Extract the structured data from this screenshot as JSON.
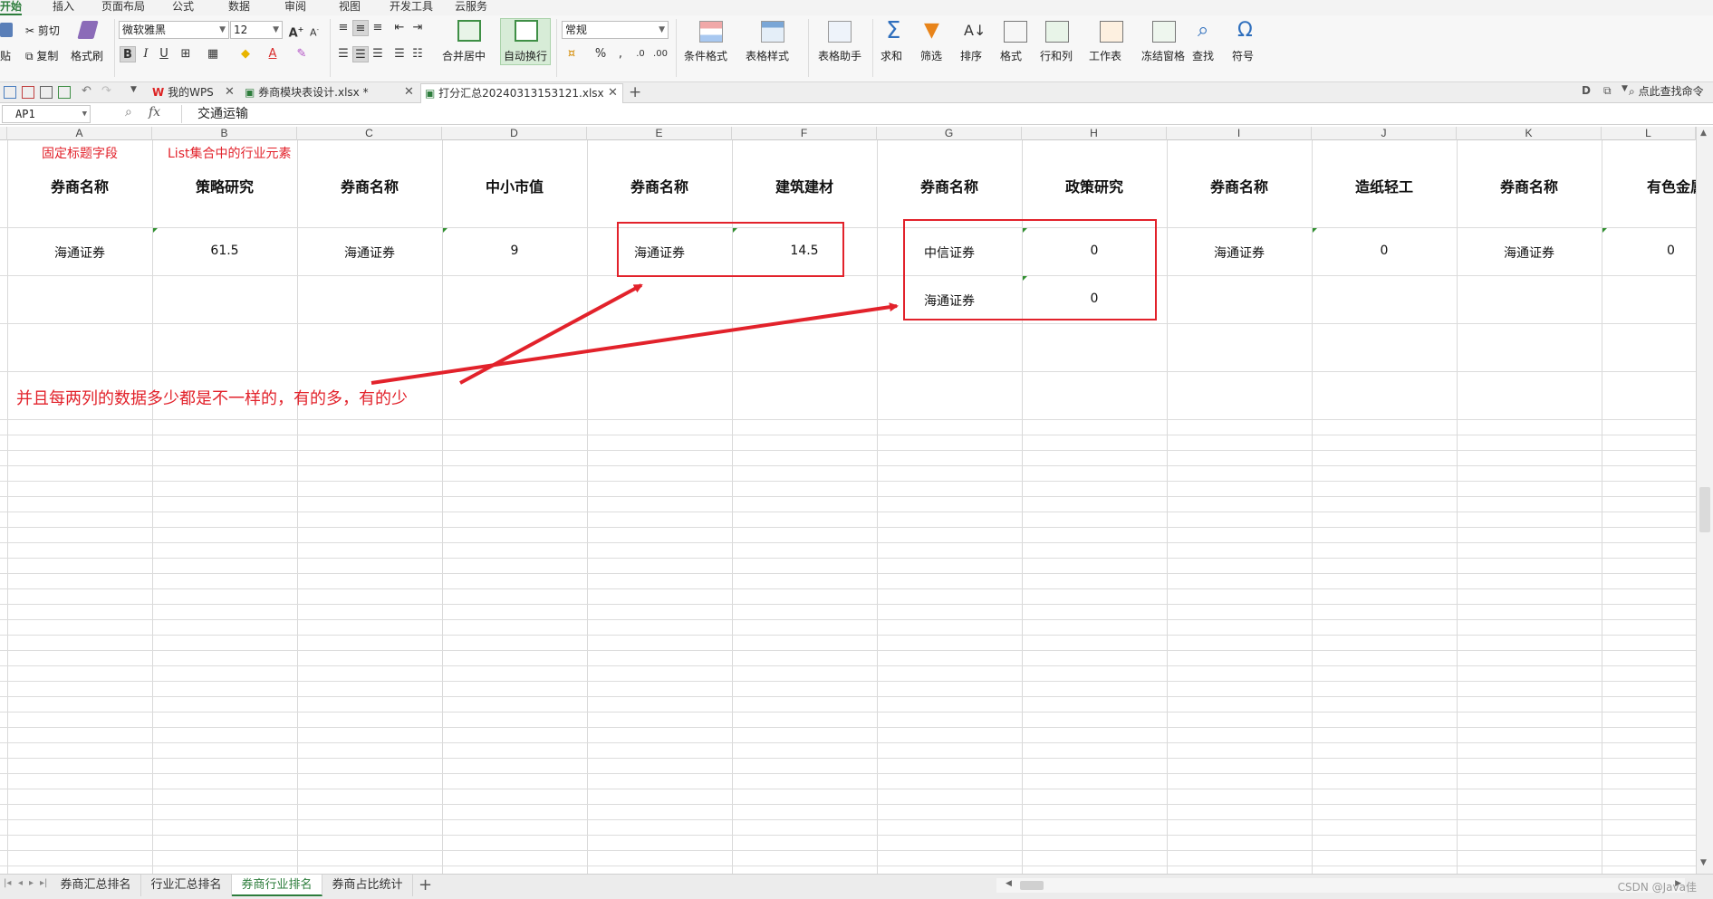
{
  "menu_tabs": [
    "开始",
    "插入",
    "页面布局",
    "公式",
    "数据",
    "审阅",
    "视图",
    "开发工具",
    "云服务"
  ],
  "ribbon": {
    "paste": "贴",
    "cut": "剪切",
    "copy": "复制",
    "format_painter": "格式刷",
    "font_name": "微软雅黑",
    "font_size": "12",
    "merge_center": "合并居中",
    "wrap_text": "自动换行",
    "number_format": "常规",
    "conditional_format": "条件格式",
    "table_style": "表格样式",
    "table_helper": "表格助手",
    "sum": "求和",
    "filter": "筛选",
    "sort": "排序",
    "format": "格式",
    "rows_cols": "行和列",
    "worksheet": "工作表",
    "freeze": "冻结窗格",
    "find": "查找",
    "symbol": "符号"
  },
  "doc_tabs": [
    {
      "label": "我的WPS",
      "active": false
    },
    {
      "label": "券商模块表设计.xlsx *",
      "active": false
    },
    {
      "label": "打分汇总20240313153121.xlsx",
      "active": true
    }
  ],
  "search_command": "点此查找命令",
  "formula_bar": {
    "cell_ref": "AP1",
    "fx": "fx",
    "value": "交通运输"
  },
  "columns": [
    "A",
    "B",
    "C",
    "D",
    "E",
    "F",
    "G",
    "H",
    "I",
    "J",
    "K",
    "L"
  ],
  "annotations": {
    "fixed_title": "固定标题字段",
    "list_elements": "List集合中的行业元素",
    "note": "并且每两列的数据多少都是不一样的，有的多，有的少"
  },
  "header_row": [
    "券商名称",
    "策略研究",
    "券商名称",
    "中小市值",
    "券商名称",
    "建筑建材",
    "券商名称",
    "政策研究",
    "券商名称",
    "造纸轻工",
    "券商名称",
    "有色金属"
  ],
  "data_rows": [
    [
      "海通证券",
      "61.5",
      "海通证券",
      "9",
      "海通证券",
      "14.5",
      "中信证券",
      "0",
      "海通证券",
      "0",
      "海通证券",
      "0"
    ],
    [
      "",
      "",
      "",
      "",
      "",
      "",
      "海通证券",
      "0",
      "",
      "",
      "",
      ""
    ]
  ],
  "sheet_tabs": [
    {
      "label": "券商汇总排名",
      "active": false
    },
    {
      "label": "行业汇总排名",
      "active": false
    },
    {
      "label": "券商行业排名",
      "active": true
    },
    {
      "label": "券商占比统计",
      "active": false
    }
  ],
  "add_sheet": "+",
  "watermark": "CSDN @Java佳",
  "colors": {
    "accent": "#2d7d3c",
    "annotation": "#e2222b"
  }
}
